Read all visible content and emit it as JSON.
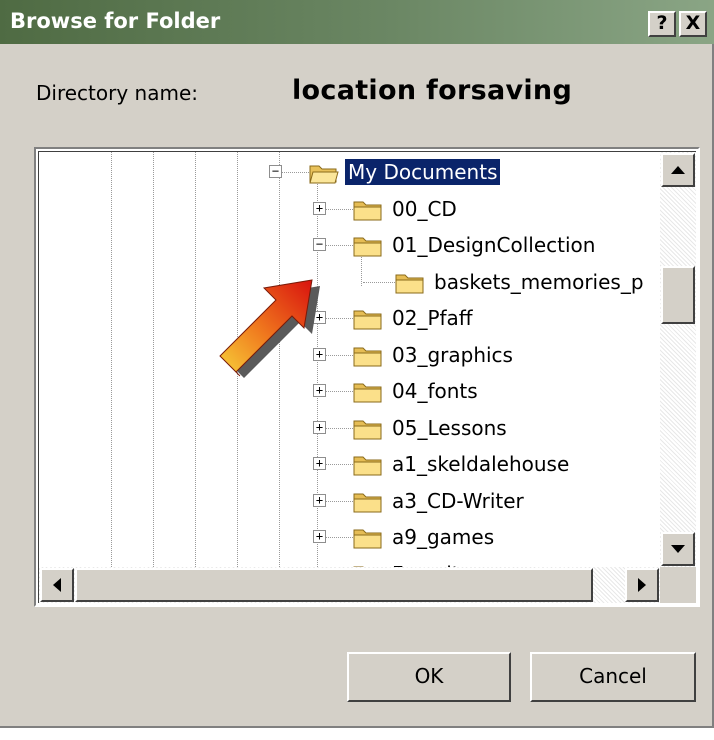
{
  "window": {
    "title": "Browse for Folder",
    "help_button": "?",
    "close_button": "X"
  },
  "directory": {
    "label": "Directory name:",
    "value": "location forsaving"
  },
  "tree": {
    "items": [
      {
        "label": "My Documents",
        "selected": true,
        "expander": "−",
        "icon": "folder-open-icon"
      },
      {
        "label": "00_CD",
        "expander": "+",
        "icon": "folder-icon"
      },
      {
        "label": "01_DesignCollection",
        "expander": "−",
        "icon": "folder-icon"
      },
      {
        "label": "baskets_memories_p",
        "expander": "",
        "icon": "folder-icon"
      },
      {
        "label": "02_Pfaff",
        "expander": "+",
        "icon": "folder-icon"
      },
      {
        "label": "03_graphics",
        "expander": "+",
        "icon": "folder-icon"
      },
      {
        "label": "04_fonts",
        "expander": "+",
        "icon": "folder-icon"
      },
      {
        "label": "05_Lessons",
        "expander": "+",
        "icon": "folder-icon"
      },
      {
        "label": "a1_skeldalehouse",
        "expander": "+",
        "icon": "folder-icon"
      },
      {
        "label": "a3_CD-Writer",
        "expander": "+",
        "icon": "folder-icon"
      },
      {
        "label": "a9_games",
        "expander": "+",
        "icon": "folder-icon"
      },
      {
        "label": "Favorites",
        "expander": "+",
        "icon": "folder-icon"
      }
    ]
  },
  "buttons": {
    "ok": "OK",
    "cancel": "Cancel"
  },
  "annotation": {
    "icon": "red-arrow-pointer-icon"
  },
  "colors": {
    "titlebar": "#5e7a55",
    "selection": "#0a246a",
    "dialog": "#d4d0c8",
    "arrow": "#e03010"
  }
}
